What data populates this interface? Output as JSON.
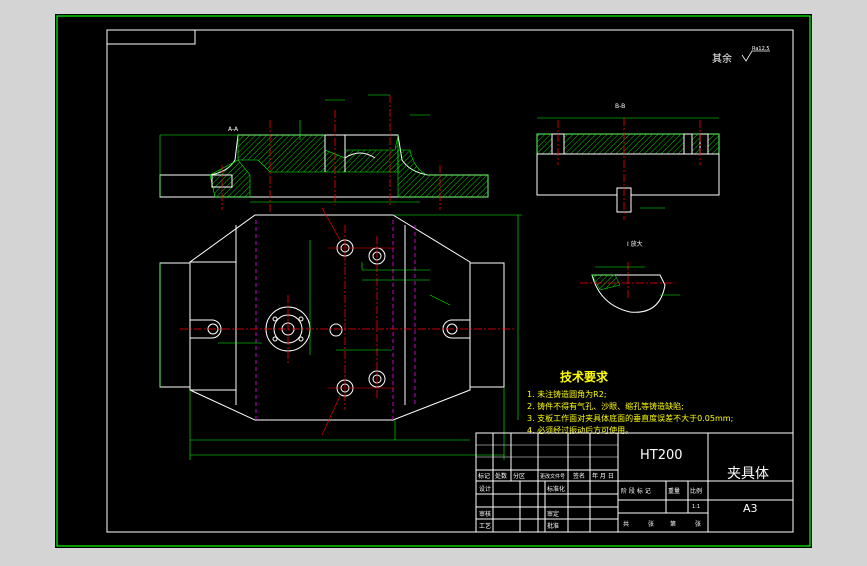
{
  "colors": {
    "background": "#d4d4d4",
    "sheet": "#000000",
    "outer_frame": "#00ff00",
    "drawing_lines": "#ffffff",
    "hatch": "#00ff00",
    "center_lines": "#ff0000",
    "hidden_lines": "#ff00ff",
    "dimension_lines": "#00ff00",
    "notes": "#ffff00"
  },
  "surface_finish": {
    "prefix": "其余",
    "symbol_value": "Ra12.5"
  },
  "views": {
    "front_section": {
      "label": "A-A"
    },
    "side_section": {
      "label": "B-B"
    },
    "detail": {
      "label": "I 放大"
    },
    "plan": {
      "label": ""
    }
  },
  "tech_requirements": {
    "title": "技术要求",
    "items": [
      "1. 未注铸造圆角为R2;",
      "2. 铸件不得有气孔、沙眼、缩孔等铸造缺陷;",
      "3. 支板工作面对夹具体底面的垂直度误差不大于0.05mm;",
      "4. 必须经过振动后方可使用。"
    ]
  },
  "title_block": {
    "material": "HT200",
    "part_name": "夹具体",
    "size": "A3",
    "scale": "1:1",
    "row_labels": [
      "标记",
      "处数",
      "分区",
      "更改文件号",
      "签名",
      "年 月 日"
    ],
    "left_labels": [
      "设计",
      "审核",
      "工艺"
    ],
    "mid_labels": [
      "标准化",
      "审定",
      "批准"
    ],
    "stage_labels": [
      "阶 段 标 记",
      "重量",
      "比例"
    ],
    "sheet_labels": [
      "共",
      "张",
      "第",
      "张"
    ]
  }
}
